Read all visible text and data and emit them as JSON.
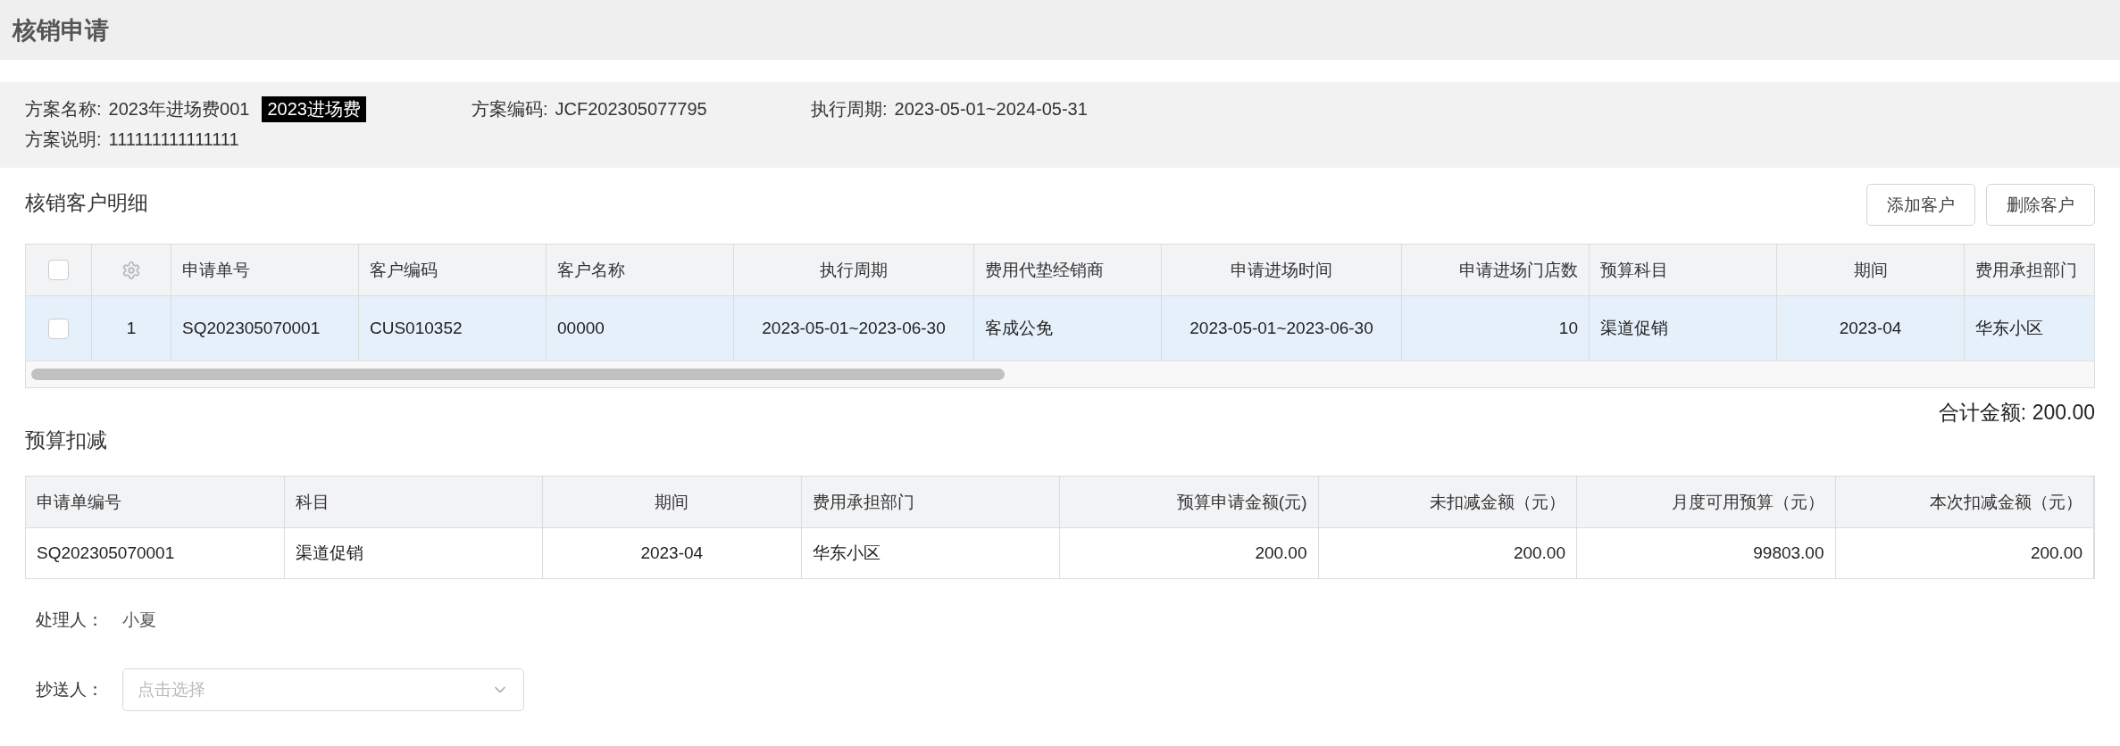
{
  "page_title": "核销申请",
  "plan": {
    "fields": [
      {
        "label": "方案名称:",
        "value": "2023年进场费001",
        "tag": "2023进场费"
      },
      {
        "label": "方案编码:",
        "value": "JCF202305077795"
      },
      {
        "label": "执行周期:",
        "value": "2023-05-01~2024-05-31"
      }
    ],
    "description": {
      "label": "方案说明:",
      "value": "111111111111111"
    }
  },
  "customers": {
    "title": "核销客户明细",
    "buttons": [
      "添加客户",
      "删除客户"
    ],
    "header_checkbox": {
      "checked": false
    },
    "columns": [
      "申请单号",
      "客户编码",
      "客户名称",
      "执行周期",
      "费用代垫经销商",
      "申请进场时间",
      "申请进场门店数",
      "预算科目",
      "期间",
      "费用承担部门"
    ],
    "rows": [
      {
        "selected": true,
        "checked": false,
        "index": "1",
        "cells": [
          "SQ202305070001",
          "CUS010352",
          "00000",
          "2023-05-01~2023-06-30",
          "客成公免",
          "2023-05-01~2023-06-30",
          "10",
          "渠道促销",
          "2023-04",
          "华东小区"
        ]
      }
    ],
    "total": "合计金额: 200.00"
  },
  "budget": {
    "title": "预算扣减",
    "columns": [
      "申请单编号",
      "科目",
      "期间",
      "费用承担部门",
      "预算申请金额(元)",
      "未扣减金额（元）",
      "月度可用预算（元）",
      "本次扣减金额（元）"
    ],
    "rows": [
      [
        "SQ202305070001",
        "渠道促销",
        "2023-04",
        "华东小区",
        "200.00",
        "200.00",
        "99803.00",
        "200.00"
      ]
    ]
  },
  "form": [
    {
      "kind": "text",
      "label": "处理人：",
      "value": "小夏"
    },
    {
      "kind": "select",
      "label": "抄送人：",
      "placeholder": "点击选择"
    }
  ]
}
